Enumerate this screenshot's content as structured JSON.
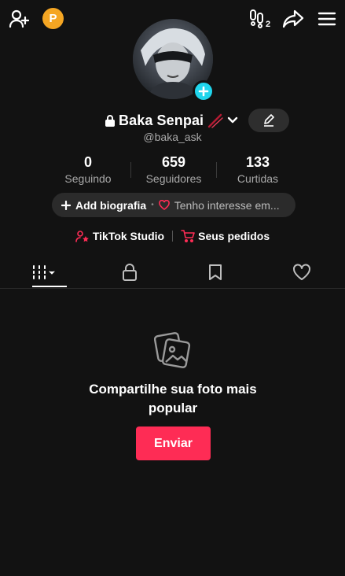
{
  "top_bar": {
    "coin_letter": "P"
  },
  "profile": {
    "display_name": "Baka Senpai",
    "username": "@baka_ask"
  },
  "stats": [
    {
      "value": "0",
      "label": "Seguindo"
    },
    {
      "value": "659",
      "label": "Seguidores"
    },
    {
      "value": "133",
      "label": "Curtidas"
    }
  ],
  "bio": {
    "add_label": "Add biografia",
    "interest_text": "Tenho interesse em..."
  },
  "links": {
    "studio_label": "TikTok Studio",
    "orders_label": "Seus pedidos"
  },
  "empty_state": {
    "message": "Compartilhe sua foto mais popular",
    "button_label": "Enviar"
  },
  "colors": {
    "background": "#121212",
    "accent_red": "#fe2c55",
    "avatar_plus": "#20d5ec",
    "coin": "#f5a623"
  }
}
